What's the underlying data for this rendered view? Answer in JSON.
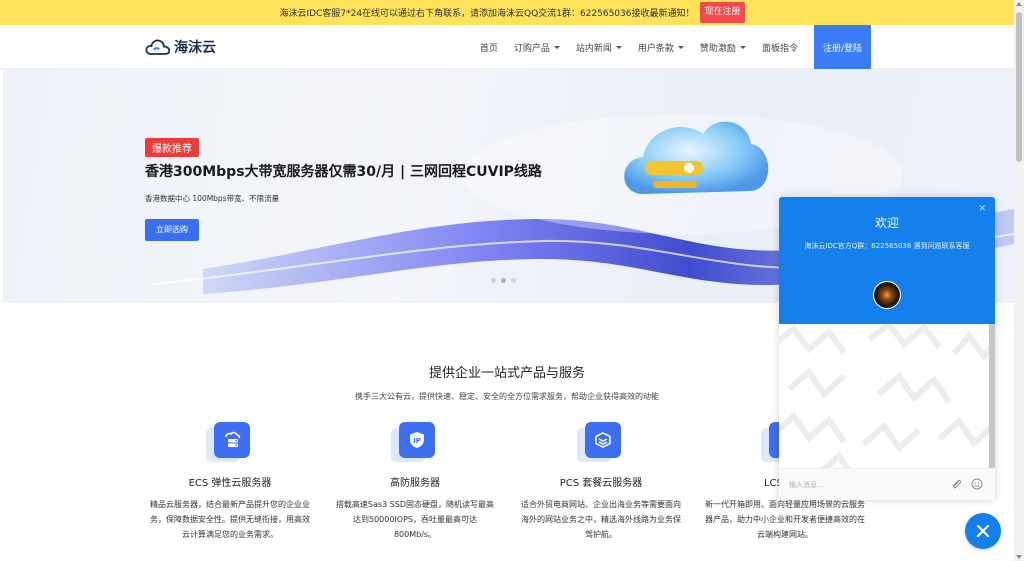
{
  "notice": {
    "text": "海沫云IDC客服7*24在线可以通过右下角联系，请添加海沫云QQ交流1群：622565036接收最新通知！",
    "register_label": "现在注册"
  },
  "header": {
    "brand": "海沫云",
    "nav": [
      {
        "label": "首页",
        "dropdown": false
      },
      {
        "label": "订购产品",
        "dropdown": true
      },
      {
        "label": "站内新闻",
        "dropdown": true
      },
      {
        "label": "用户条款",
        "dropdown": true
      },
      {
        "label": "赞助激励",
        "dropdown": true
      },
      {
        "label": "面板指令",
        "dropdown": false
      }
    ],
    "login_label": "注册/登陆"
  },
  "hero": {
    "badge": "爆款推荐",
    "title": "香港300Mbps大带宽服务器仅需30/月 | 三网回程CUVIP线路",
    "subtitle": "香港数据中心 100Mbps带宽、不限流量",
    "cta": "立即选购"
  },
  "services": {
    "title": "提供企业一站式产品与服务",
    "subtitle": "携手三大公有云，提供快速、稳定、安全的全方位需求服务，帮助企业获得高效的动能",
    "cards": [
      {
        "name": "ECS 弹性云服务器",
        "icon": "server-icon",
        "desc": "精品云服务器，结合最新产品提升您的企业业务，保障数据安全性。提供无缝衔接，用高效云计算满足您的业务需求。"
      },
      {
        "name": "高防服务器",
        "icon": "ip-shield-icon",
        "desc": "搭载高速Sas3 SSD固态硬盘，随机读写最高达到50000IOPS，吞吐量最高可达800Mb/s。"
      },
      {
        "name": "PCS 套餐云服务器",
        "icon": "layers-icon",
        "desc": "适合外贸电商网站、企业出海业务等需要面向海外的网站业务之中，精选海外线路为业务保驾护航。"
      },
      {
        "name": "LCS 轻量",
        "icon": "cloud-icon",
        "desc": "新一代开箱即用、面向轻量应用场景的云服务器产品，助力中小企业和开发者便捷高效的在云端构建网站。"
      }
    ]
  },
  "chat": {
    "welcome": "欢迎",
    "qq_line": "海沫云IDC官方Q群：622565036 遇到问题联系客服",
    "input_placeholder": "输入消息..."
  },
  "colors": {
    "accent": "#3a7cf5",
    "notice_bg": "#fde25a",
    "badge_red": "#ec3b3b",
    "chat_blue": "#1580ec"
  }
}
